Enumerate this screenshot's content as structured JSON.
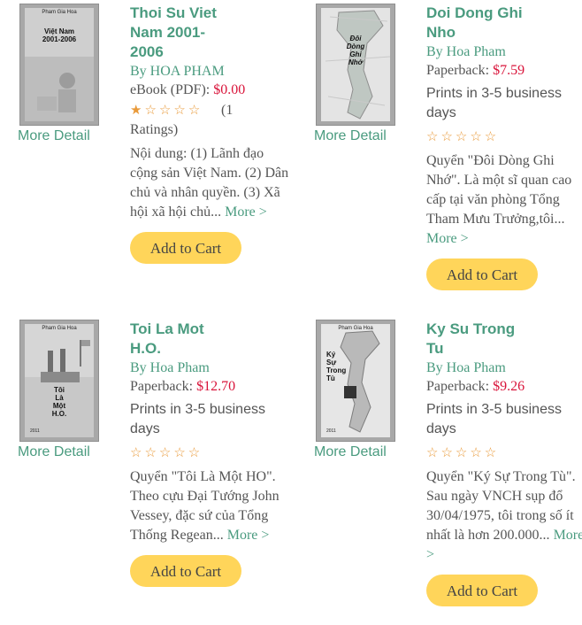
{
  "colors": {
    "accent": "#4a9b7f",
    "price": "#d9143a",
    "star": "#e99a3a",
    "cart_bg": "#ffd55a"
  },
  "products": [
    {
      "cover_author": "Pham Gia Hoa",
      "cover_title": "Việt Nam\n2001-2006",
      "more_detail": "More Detail",
      "title": "Thoi Su Viet Nam 2001-2006",
      "by": "By HOA PHAM",
      "format_label": "eBook (PDF): ",
      "price": "$0.00",
      "rating": 1,
      "ratings_text": "(1 Ratings)",
      "desc": "Nội dung: (1) Lãnh đạo cộng sản Việt Nam. (2) Dân chủ và nhân quyền. (3) Xã hội xã hội chủ...",
      "more": "More >",
      "cart": "Add to Cart"
    },
    {
      "cover_author": "Pham Gia Hoa",
      "cover_title": "Đôi\nDòng\nGhi\nNhớ",
      "more_detail": "More Detail",
      "title": "Doi Dong Ghi Nho",
      "by": "By Hoa Pham",
      "format_label": "Paperback: ",
      "price": "$7.59",
      "prints": "Prints in 3-5 business days",
      "rating": 0,
      "desc": "Quyển \"Đôi Dòng Ghi Nhớ\". Là một sĩ quan cao cấp tại văn phòng Tổng Tham Mưu Trưởng,tôi...",
      "more": "More >",
      "cart": "Add to Cart"
    },
    {
      "cover_author": "Pham Gia Hoa",
      "cover_title": "Tôi\nLà\nMột\nH.O.",
      "cover_year": "2011",
      "more_detail": "More Detail",
      "title": "Toi La Mot H.O.",
      "by": "By Hoa Pham",
      "format_label": "Paperback: ",
      "price": "$12.70",
      "prints": "Prints in 3-5 business days",
      "rating": 0,
      "desc": "Quyển \"Tôi Là Một HO\". Theo cựu Đại Tướng John Vessey, đặc sứ của Tổng Thống Regean...",
      "more": "More >",
      "cart": "Add to Cart"
    },
    {
      "cover_author": "Pham Gia Hoa",
      "cover_title": "Ký\nSự\nTrong\nTù",
      "cover_year": "2011",
      "more_detail": "More Detail",
      "title": "Ky Su Trong Tu",
      "by": "By Hoa Pham",
      "format_label": "Paperback: ",
      "price": "$9.26",
      "prints": "Prints in 3-5 business days",
      "rating": 0,
      "desc": "Quyển \"Ký Sự Trong Tù\". Sau ngày VNCH sụp đổ 30/04/1975, tôi trong số ít nhất là hơn 200.000...",
      "more": "More >",
      "cart": "Add to Cart"
    }
  ]
}
